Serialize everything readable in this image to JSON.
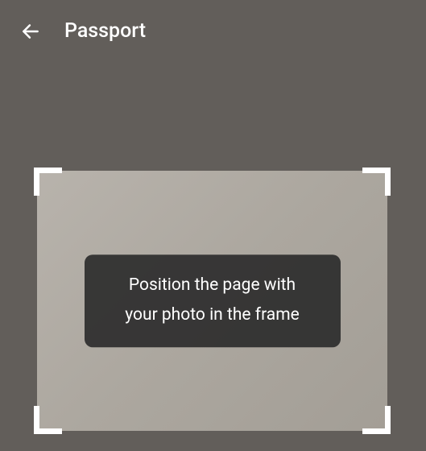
{
  "header": {
    "title": "Passport",
    "back_icon": "arrow-left"
  },
  "scanner": {
    "instruction_line1": "Position the page with",
    "instruction_line2": "your photo in the frame"
  }
}
